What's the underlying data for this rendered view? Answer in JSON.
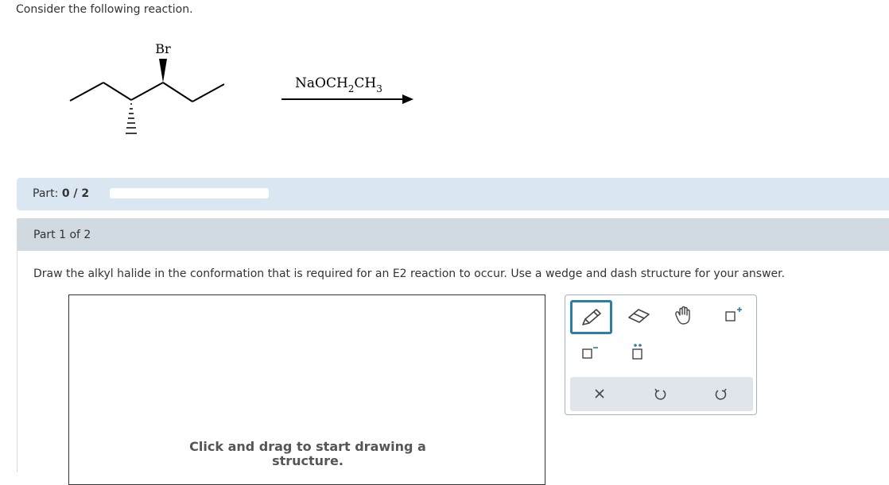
{
  "intro": "Consider the following reaction.",
  "reaction": {
    "substituent": "Br",
    "reagent_prefix": "NaOCH",
    "reagent_sub1": "2",
    "reagent_mid": "CH",
    "reagent_sub2": "3"
  },
  "part_bar": {
    "label": "Part:",
    "score": "0 / 2",
    "progress_fraction": 0
  },
  "part_header": "Part 1 of 2",
  "question": "Draw the alkyl halide in the conformation that is required for an E2 reaction to occur. Use a wedge and dash structure for your answer.",
  "canvas": {
    "hint": "Click and drag to start drawing a structure."
  },
  "toolbar": {
    "tools": [
      "pencil-icon",
      "eraser-icon",
      "hand-icon",
      "add-charge-icon",
      "remove-charge-icon",
      "lone-pair-icon"
    ],
    "actions": [
      "clear-icon",
      "undo-icon",
      "redo-icon"
    ],
    "accent_color": "#2d7ea6"
  }
}
